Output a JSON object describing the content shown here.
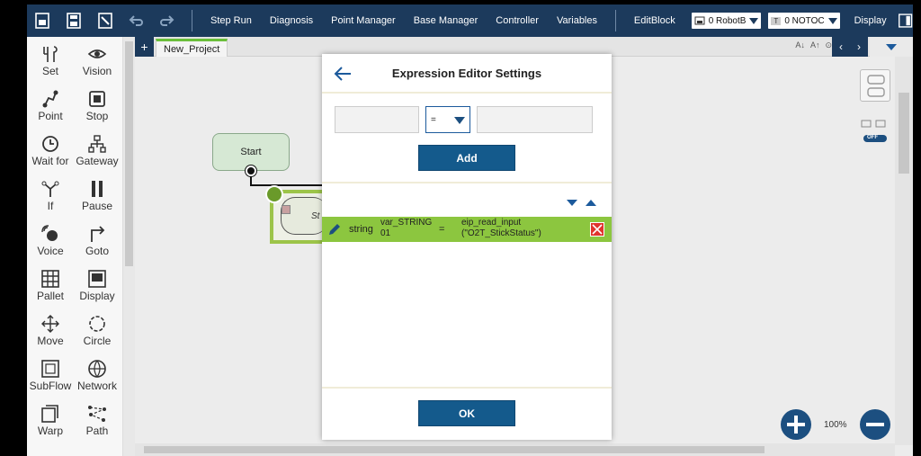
{
  "toolbar": {
    "menu": [
      "Step Run",
      "Diagnosis",
      "Point Manager",
      "Base Manager",
      "Controller",
      "Variables",
      "EditBlock"
    ],
    "robot_select": "0 RobotB",
    "tool_select_badge": "T",
    "tool_select": "0 NOTOC",
    "display_label": "Display",
    "icons": [
      "new-file-icon",
      "save-icon",
      "export-icon",
      "undo-icon",
      "redo-icon"
    ]
  },
  "palette": {
    "items": [
      {
        "label": "Set",
        "icon": "wrench-icon"
      },
      {
        "label": "Vision",
        "icon": "eye-icon"
      },
      {
        "label": "Point",
        "icon": "point-icon"
      },
      {
        "label": "Stop",
        "icon": "stop-icon"
      },
      {
        "label": "Wait for",
        "icon": "clock-icon"
      },
      {
        "label": "Gateway",
        "icon": "gateway-icon"
      },
      {
        "label": "If",
        "icon": "branch-icon"
      },
      {
        "label": "Pause",
        "icon": "pause-icon"
      },
      {
        "label": "Voice",
        "icon": "voice-icon"
      },
      {
        "label": "Goto",
        "icon": "goto-icon"
      },
      {
        "label": "Pallet",
        "icon": "pallet-icon"
      },
      {
        "label": "Display",
        "icon": "display-icon"
      },
      {
        "label": "Move",
        "icon": "move-icon"
      },
      {
        "label": "Circle",
        "icon": "circle-icon"
      },
      {
        "label": "SubFlow",
        "icon": "subflow-icon"
      },
      {
        "label": "Network",
        "icon": "network-icon"
      },
      {
        "label": "Warp",
        "icon": "warp-icon"
      },
      {
        "label": "Path",
        "icon": "path-icon"
      }
    ]
  },
  "canvas": {
    "tab_plus": "+",
    "project_tab": "New_Project",
    "tab_tools": [
      "A↓",
      "A↑",
      "⊙"
    ],
    "start_node": "Start",
    "node_label": "St",
    "zoom": "100%",
    "off_badge": "OFF"
  },
  "modal": {
    "title": "Expression Editor Settings",
    "operator": "=",
    "add_label": "Add",
    "ok_label": "OK",
    "expression": {
      "type": "string",
      "variable": "var_STRING 01",
      "operator": "=",
      "value": "eip_read_input (\"O2T_StickStatus\")"
    }
  },
  "colors": {
    "toolbar_bg": "#1c3a5c",
    "primary": "#145a8c",
    "row_highlight": "#8cc63f",
    "delete": "#e0342e"
  }
}
